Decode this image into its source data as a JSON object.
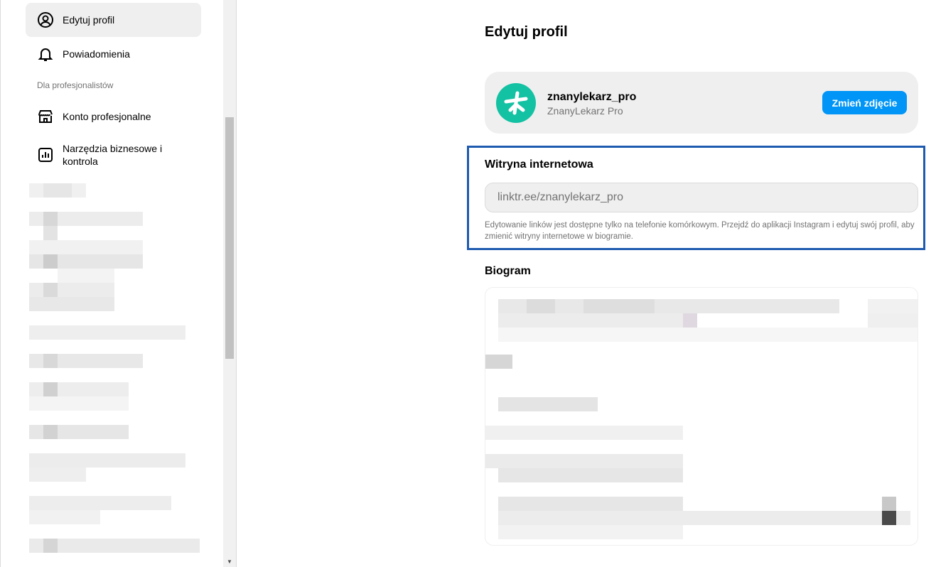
{
  "sidebar": {
    "items": [
      {
        "label": "Edytuj profil",
        "icon": "user-circle-icon"
      },
      {
        "label": "Powiadomienia",
        "icon": "bell-icon"
      },
      {
        "label": "Konto profesjonalne",
        "icon": "storefront-icon"
      },
      {
        "label": "Narzędzia biznesowe i kontrola",
        "icon": "bar-chart-icon"
      }
    ],
    "section_label": "Dla profesjonalistów"
  },
  "main": {
    "title": "Edytuj profil",
    "profile": {
      "username": "znanylekarz_pro",
      "full_name": "ZnanyLekarz Pro",
      "change_photo_label": "Zmień zdjęcie"
    },
    "website": {
      "title": "Witryna internetowa",
      "value": "linktr.ee/znanylekarz_pro",
      "helper": "Edytowanie linków jest dostępne tylko na telefonie komórkowym. Przejdź do aplikacji Instagram i edytuj swój profil, aby zmienić witryny internetowe w biogramie."
    },
    "bio": {
      "title": "Biogram"
    }
  },
  "colors": {
    "accent": "#0095f6",
    "highlight_border": "#1e5bb0",
    "avatar_bg": "#13c1a3"
  }
}
